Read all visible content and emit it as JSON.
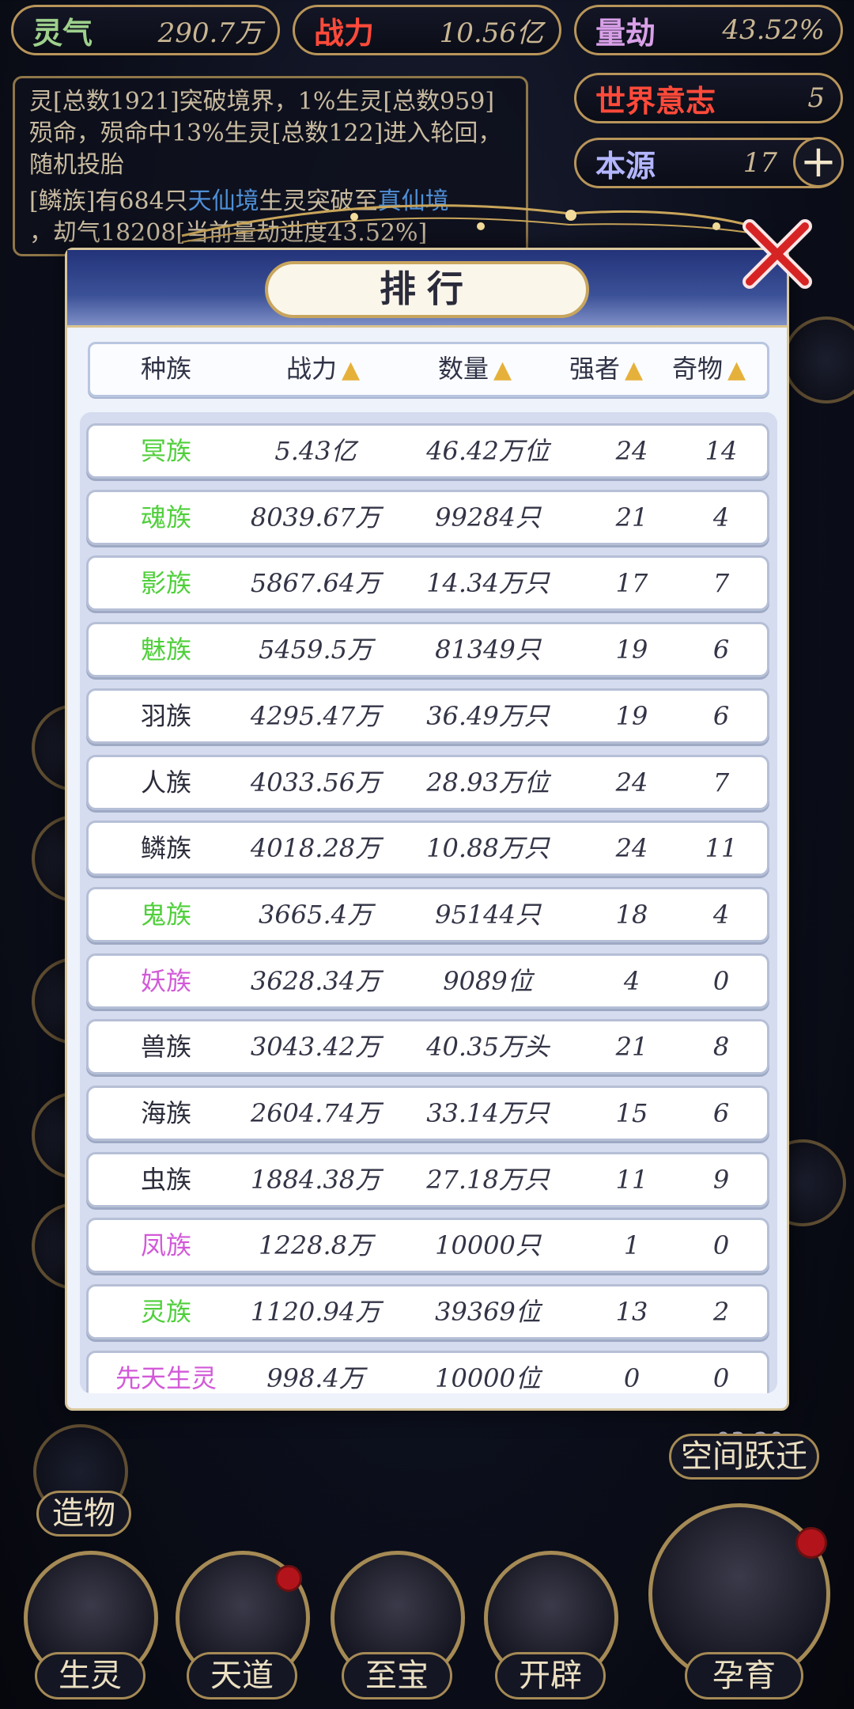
{
  "top_stats": {
    "lingqi": {
      "label": "灵气",
      "value": "290.7万"
    },
    "zhanli": {
      "label": "战力",
      "value": "10.56亿"
    },
    "liangjie": {
      "label": "量劫",
      "value": "43.52%"
    },
    "world_will": {
      "label": "世界意志",
      "value": "5"
    },
    "benyuan": {
      "label": "本源",
      "value": "17"
    }
  },
  "log": {
    "line1": "灵[总数1921]突破境界，1%生灵[总数959]殒命，殒命中13%生灵[总数122]进入轮回，随机投胎",
    "line2_prefix": "[鳞族]有684只",
    "line2_hl1": "天仙境",
    "line2_mid": "生灵突破至",
    "line2_hl2": "真仙境",
    "line3": "，刧气18208[当前量劫进度43.52%]"
  },
  "side_labels": {
    "zaowu": "造物",
    "kongjian": "空间跃迁",
    "timer": "03:20"
  },
  "bottom_nav": [
    {
      "label": "生灵"
    },
    {
      "label": "天道"
    },
    {
      "label": "至宝"
    },
    {
      "label": "开辟"
    },
    {
      "label": "孕育"
    }
  ],
  "modal": {
    "title": "排行",
    "columns": [
      "种族",
      "战力",
      "数量",
      "强者",
      "奇物"
    ],
    "rows": [
      {
        "name": "冥族",
        "power": "5.43亿",
        "count": "46.42万位",
        "strong": "24",
        "item": "14",
        "color": "#4fcf3a"
      },
      {
        "name": "魂族",
        "power": "8039.67万",
        "count": "99284只",
        "strong": "21",
        "item": "4",
        "color": "#4fcf3a"
      },
      {
        "name": "影族",
        "power": "5867.64万",
        "count": "14.34万只",
        "strong": "17",
        "item": "7",
        "color": "#4fcf3a"
      },
      {
        "name": "魅族",
        "power": "5459.5万",
        "count": "81349只",
        "strong": "19",
        "item": "6",
        "color": "#4fcf3a"
      },
      {
        "name": "羽族",
        "power": "4295.47万",
        "count": "36.49万只",
        "strong": "19",
        "item": "6",
        "color": "#2b2c3a"
      },
      {
        "name": "人族",
        "power": "4033.56万",
        "count": "28.93万位",
        "strong": "24",
        "item": "7",
        "color": "#2b2c3a"
      },
      {
        "name": "鳞族",
        "power": "4018.28万",
        "count": "10.88万只",
        "strong": "24",
        "item": "11",
        "color": "#2b2c3a"
      },
      {
        "name": "鬼族",
        "power": "3665.4万",
        "count": "95144只",
        "strong": "18",
        "item": "4",
        "color": "#4fcf3a"
      },
      {
        "name": "妖族",
        "power": "3628.34万",
        "count": "9089位",
        "strong": "4",
        "item": "0",
        "color": "#d25ad8"
      },
      {
        "name": "兽族",
        "power": "3043.42万",
        "count": "40.35万头",
        "strong": "21",
        "item": "8",
        "color": "#2b2c3a"
      },
      {
        "name": "海族",
        "power": "2604.74万",
        "count": "33.14万只",
        "strong": "15",
        "item": "6",
        "color": "#2b2c3a"
      },
      {
        "name": "虫族",
        "power": "1884.38万",
        "count": "27.18万只",
        "strong": "11",
        "item": "9",
        "color": "#2b2c3a"
      },
      {
        "name": "凤族",
        "power": "1228.8万",
        "count": "10000只",
        "strong": "1",
        "item": "0",
        "color": "#d25ad8"
      },
      {
        "name": "灵族",
        "power": "1120.94万",
        "count": "39369位",
        "strong": "13",
        "item": "2",
        "color": "#4fcf3a"
      },
      {
        "name": "先天生灵",
        "power": "998.4万",
        "count": "10000位",
        "strong": "0",
        "item": "0",
        "color": "#d25ad8"
      }
    ]
  }
}
